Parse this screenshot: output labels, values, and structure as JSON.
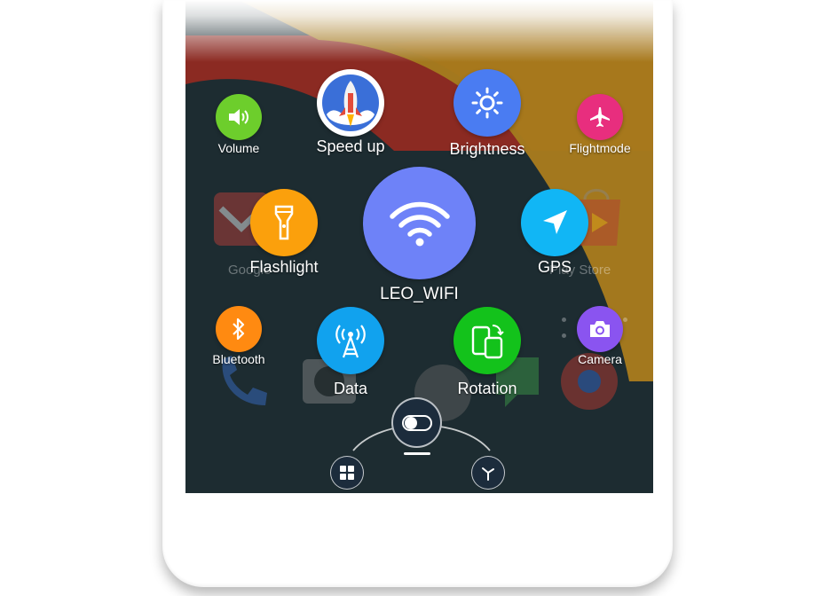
{
  "center_toggle": {
    "label": "LEO_WIFI",
    "icon": "wifi-icon",
    "color": "#6e82f8"
  },
  "toggles": [
    {
      "label": "Volume",
      "icon": "volume-icon",
      "color": "#6dce2c"
    },
    {
      "label": "Speed up",
      "icon": "rocket-icon",
      "color": "#3a6fd8"
    },
    {
      "label": "Brightness",
      "icon": "sun-icon",
      "color": "#4a7cf2"
    },
    {
      "label": "Flightmode",
      "icon": "airplane-icon",
      "color": "#e82e7e"
    },
    {
      "label": "Flashlight",
      "icon": "flashlight-icon",
      "color": "#fba00c"
    },
    {
      "label": "GPS",
      "icon": "navigation-arrow-icon",
      "color": "#11b6f5"
    },
    {
      "label": "Bluetooth",
      "icon": "bluetooth-icon",
      "color": "#ff8a11"
    },
    {
      "label": "Data",
      "icon": "cell-tower-icon",
      "color": "#11a2ee"
    },
    {
      "label": "Rotation",
      "icon": "phone-rotate-icon",
      "color": "#13c21b"
    },
    {
      "label": "Camera",
      "icon": "camera-icon",
      "color": "#8a54f0"
    }
  ],
  "background_apps": [
    "Google",
    "Play Store"
  ],
  "dock": [
    {
      "icon": "apps-grid-icon"
    },
    {
      "icon": "toggle-switch-icon",
      "active": true
    },
    {
      "icon": "clock-icon"
    }
  ]
}
